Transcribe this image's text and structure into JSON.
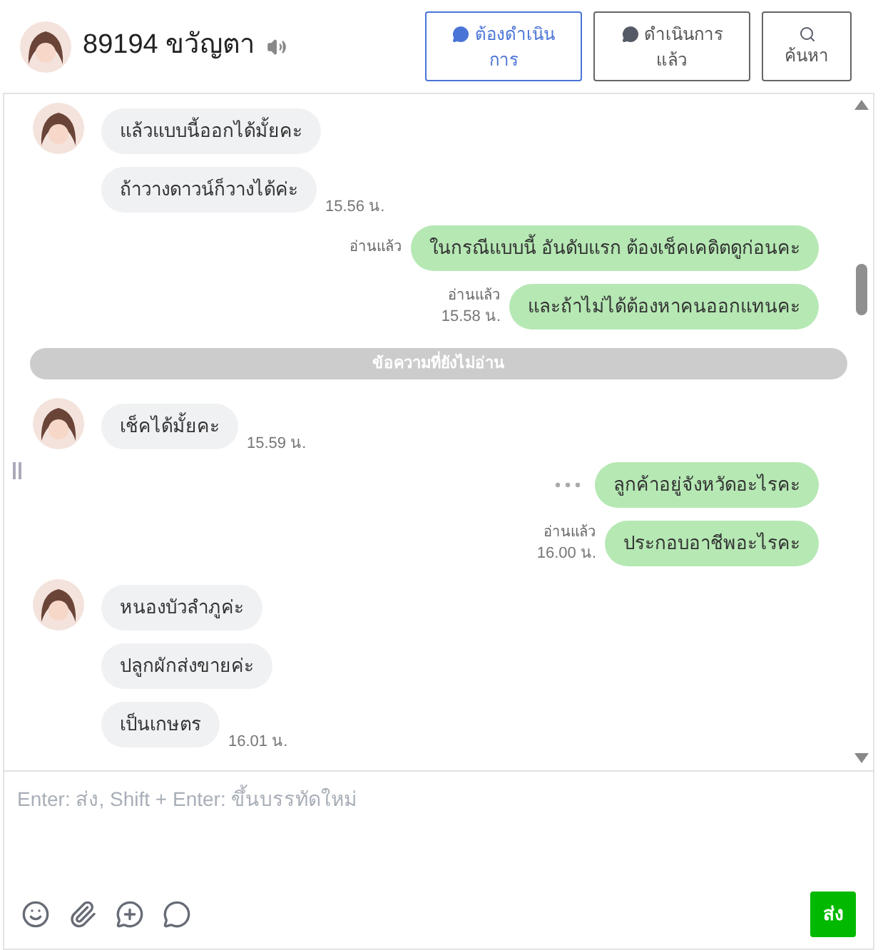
{
  "header": {
    "name": "89194 ขวัญตา"
  },
  "header_buttons": [
    {
      "kind": "todo",
      "label": "ต้องดำเนินการ",
      "selected": true
    },
    {
      "kind": "done",
      "label": "ดำเนินการแล้ว",
      "selected": false
    },
    {
      "kind": "search",
      "label": "ค้นหา",
      "selected": false
    }
  ],
  "messages": [
    {
      "kind": "in",
      "text": "แล้วแบบนี้ออกได้มั้ยคะ",
      "avatar": true
    },
    {
      "kind": "in",
      "text": "ถ้าวางดาวน์ก็วางได้ค่ะ",
      "avatar": false,
      "time": "15.56 น."
    },
    {
      "kind": "out",
      "text": "ในกรณีแบบนี้ อันดับแรก ต้องเช็คเคดิตดูก่อนคะ",
      "read": "อ่านแล้ว",
      "more": false
    },
    {
      "kind": "out",
      "text": "และถ้าไม่ได้ต้องหาคนออกแทนคะ",
      "read": "อ่านแล้ว",
      "time": "15.58 น.",
      "more": false
    },
    {
      "kind": "divider",
      "text": "ข้อความที่ยังไม่อ่าน"
    },
    {
      "kind": "in",
      "text": "เช็คได้มั้ยคะ",
      "avatar": true,
      "time": "15.59 น."
    },
    {
      "kind": "out",
      "text": "ลูกค้าอยู่จังหวัดอะไรคะ",
      "more": true
    },
    {
      "kind": "out",
      "text": "ประกอบอาชีพอะไรคะ",
      "read": "อ่านแล้ว",
      "time": "16.00 น.",
      "more": false
    },
    {
      "kind": "in",
      "text": "หนองบัวลำภูค่ะ",
      "avatar": true
    },
    {
      "kind": "in",
      "text": "ปลูกผักส่งขายค่ะ",
      "avatar": false
    },
    {
      "kind": "in",
      "text": "เป็นเกษตร",
      "avatar": false,
      "time": "16.01 น."
    }
  ],
  "composer": {
    "placeholder": "Enter: ส่ง, Shift + Enter: ขึ้นบรรทัดใหม่",
    "send": "ส่ง"
  }
}
